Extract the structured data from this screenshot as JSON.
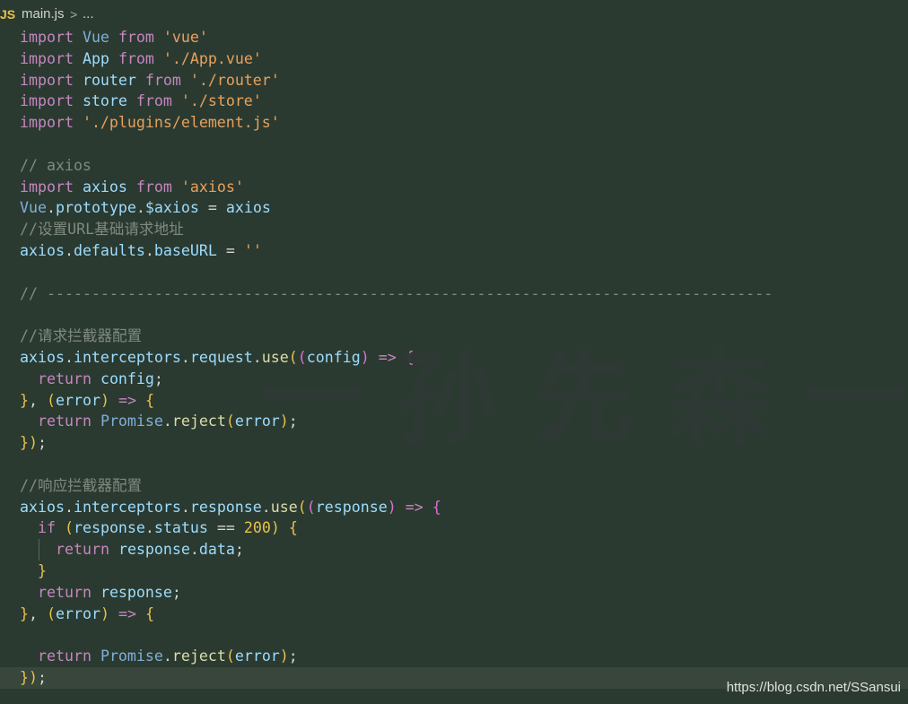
{
  "breadcrumb": {
    "language_badge": "JS",
    "file": "main.js",
    "separator": ">",
    "more": "..."
  },
  "code_lines": [
    "import Vue from 'vue'",
    "import App from './App.vue'",
    "import router from './router'",
    "import store from './store'",
    "import './plugins/element.js'",
    "",
    "// axios",
    "import axios from 'axios'",
    "Vue.prototype.$axios = axios",
    "//设置URL基础请求地址",
    "axios.defaults.baseURL = ''",
    "",
    "// ---------------------------------------------------------------------------------",
    "",
    "//请求拦截器配置",
    "axios.interceptors.request.use((config) => {",
    "  return config;",
    "}, (error) => {",
    "  return Promise.reject(error);",
    "});",
    "",
    "//响应拦截器配置",
    "axios.interceptors.response.use((response) => {",
    "  if (response.status == 200) {",
    "    return response.data;",
    "  }",
    "  return response;",
    "}, (error) => {",
    "",
    "  return Promise.reject(error);",
    "});"
  ],
  "watermark_text": "一孙先森一",
  "site_watermark": "https://blog.csdn.net/SSansui",
  "colors": {
    "background": "#2b3a30",
    "keyword": "#c586c0",
    "string": "#ce9178",
    "comment": "#7f8a80",
    "number": "#e8c14a"
  }
}
